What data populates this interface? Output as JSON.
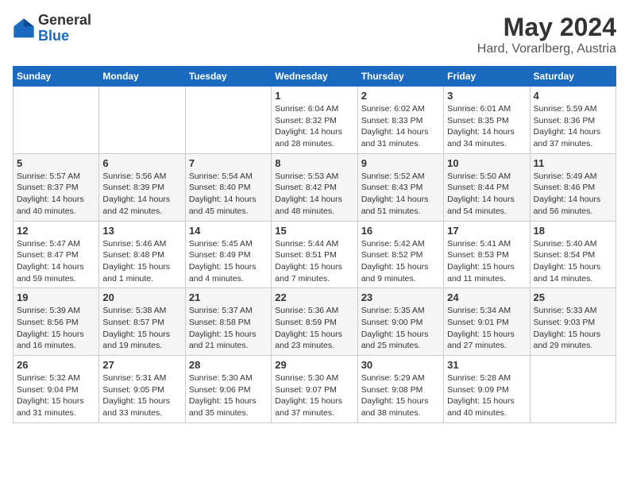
{
  "logo": {
    "general": "General",
    "blue": "Blue"
  },
  "title": {
    "month_year": "May 2024",
    "location": "Hard, Vorarlberg, Austria"
  },
  "weekdays": [
    "Sunday",
    "Monday",
    "Tuesday",
    "Wednesday",
    "Thursday",
    "Friday",
    "Saturday"
  ],
  "weeks": [
    [
      {
        "day": "",
        "detail": ""
      },
      {
        "day": "",
        "detail": ""
      },
      {
        "day": "",
        "detail": ""
      },
      {
        "day": "1",
        "detail": "Sunrise: 6:04 AM\nSunset: 8:32 PM\nDaylight: 14 hours\nand 28 minutes."
      },
      {
        "day": "2",
        "detail": "Sunrise: 6:02 AM\nSunset: 8:33 PM\nDaylight: 14 hours\nand 31 minutes."
      },
      {
        "day": "3",
        "detail": "Sunrise: 6:01 AM\nSunset: 8:35 PM\nDaylight: 14 hours\nand 34 minutes."
      },
      {
        "day": "4",
        "detail": "Sunrise: 5:59 AM\nSunset: 8:36 PM\nDaylight: 14 hours\nand 37 minutes."
      }
    ],
    [
      {
        "day": "5",
        "detail": "Sunrise: 5:57 AM\nSunset: 8:37 PM\nDaylight: 14 hours\nand 40 minutes."
      },
      {
        "day": "6",
        "detail": "Sunrise: 5:56 AM\nSunset: 8:39 PM\nDaylight: 14 hours\nand 42 minutes."
      },
      {
        "day": "7",
        "detail": "Sunrise: 5:54 AM\nSunset: 8:40 PM\nDaylight: 14 hours\nand 45 minutes."
      },
      {
        "day": "8",
        "detail": "Sunrise: 5:53 AM\nSunset: 8:42 PM\nDaylight: 14 hours\nand 48 minutes."
      },
      {
        "day": "9",
        "detail": "Sunrise: 5:52 AM\nSunset: 8:43 PM\nDaylight: 14 hours\nand 51 minutes."
      },
      {
        "day": "10",
        "detail": "Sunrise: 5:50 AM\nSunset: 8:44 PM\nDaylight: 14 hours\nand 54 minutes."
      },
      {
        "day": "11",
        "detail": "Sunrise: 5:49 AM\nSunset: 8:46 PM\nDaylight: 14 hours\nand 56 minutes."
      }
    ],
    [
      {
        "day": "12",
        "detail": "Sunrise: 5:47 AM\nSunset: 8:47 PM\nDaylight: 14 hours\nand 59 minutes."
      },
      {
        "day": "13",
        "detail": "Sunrise: 5:46 AM\nSunset: 8:48 PM\nDaylight: 15 hours\nand 1 minute."
      },
      {
        "day": "14",
        "detail": "Sunrise: 5:45 AM\nSunset: 8:49 PM\nDaylight: 15 hours\nand 4 minutes."
      },
      {
        "day": "15",
        "detail": "Sunrise: 5:44 AM\nSunset: 8:51 PM\nDaylight: 15 hours\nand 7 minutes."
      },
      {
        "day": "16",
        "detail": "Sunrise: 5:42 AM\nSunset: 8:52 PM\nDaylight: 15 hours\nand 9 minutes."
      },
      {
        "day": "17",
        "detail": "Sunrise: 5:41 AM\nSunset: 8:53 PM\nDaylight: 15 hours\nand 11 minutes."
      },
      {
        "day": "18",
        "detail": "Sunrise: 5:40 AM\nSunset: 8:54 PM\nDaylight: 15 hours\nand 14 minutes."
      }
    ],
    [
      {
        "day": "19",
        "detail": "Sunrise: 5:39 AM\nSunset: 8:56 PM\nDaylight: 15 hours\nand 16 minutes."
      },
      {
        "day": "20",
        "detail": "Sunrise: 5:38 AM\nSunset: 8:57 PM\nDaylight: 15 hours\nand 19 minutes."
      },
      {
        "day": "21",
        "detail": "Sunrise: 5:37 AM\nSunset: 8:58 PM\nDaylight: 15 hours\nand 21 minutes."
      },
      {
        "day": "22",
        "detail": "Sunrise: 5:36 AM\nSunset: 8:59 PM\nDaylight: 15 hours\nand 23 minutes."
      },
      {
        "day": "23",
        "detail": "Sunrise: 5:35 AM\nSunset: 9:00 PM\nDaylight: 15 hours\nand 25 minutes."
      },
      {
        "day": "24",
        "detail": "Sunrise: 5:34 AM\nSunset: 9:01 PM\nDaylight: 15 hours\nand 27 minutes."
      },
      {
        "day": "25",
        "detail": "Sunrise: 5:33 AM\nSunset: 9:03 PM\nDaylight: 15 hours\nand 29 minutes."
      }
    ],
    [
      {
        "day": "26",
        "detail": "Sunrise: 5:32 AM\nSunset: 9:04 PM\nDaylight: 15 hours\nand 31 minutes."
      },
      {
        "day": "27",
        "detail": "Sunrise: 5:31 AM\nSunset: 9:05 PM\nDaylight: 15 hours\nand 33 minutes."
      },
      {
        "day": "28",
        "detail": "Sunrise: 5:30 AM\nSunset: 9:06 PM\nDaylight: 15 hours\nand 35 minutes."
      },
      {
        "day": "29",
        "detail": "Sunrise: 5:30 AM\nSunset: 9:07 PM\nDaylight: 15 hours\nand 37 minutes."
      },
      {
        "day": "30",
        "detail": "Sunrise: 5:29 AM\nSunset: 9:08 PM\nDaylight: 15 hours\nand 38 minutes."
      },
      {
        "day": "31",
        "detail": "Sunrise: 5:28 AM\nSunset: 9:09 PM\nDaylight: 15 hours\nand 40 minutes."
      },
      {
        "day": "",
        "detail": ""
      }
    ]
  ]
}
